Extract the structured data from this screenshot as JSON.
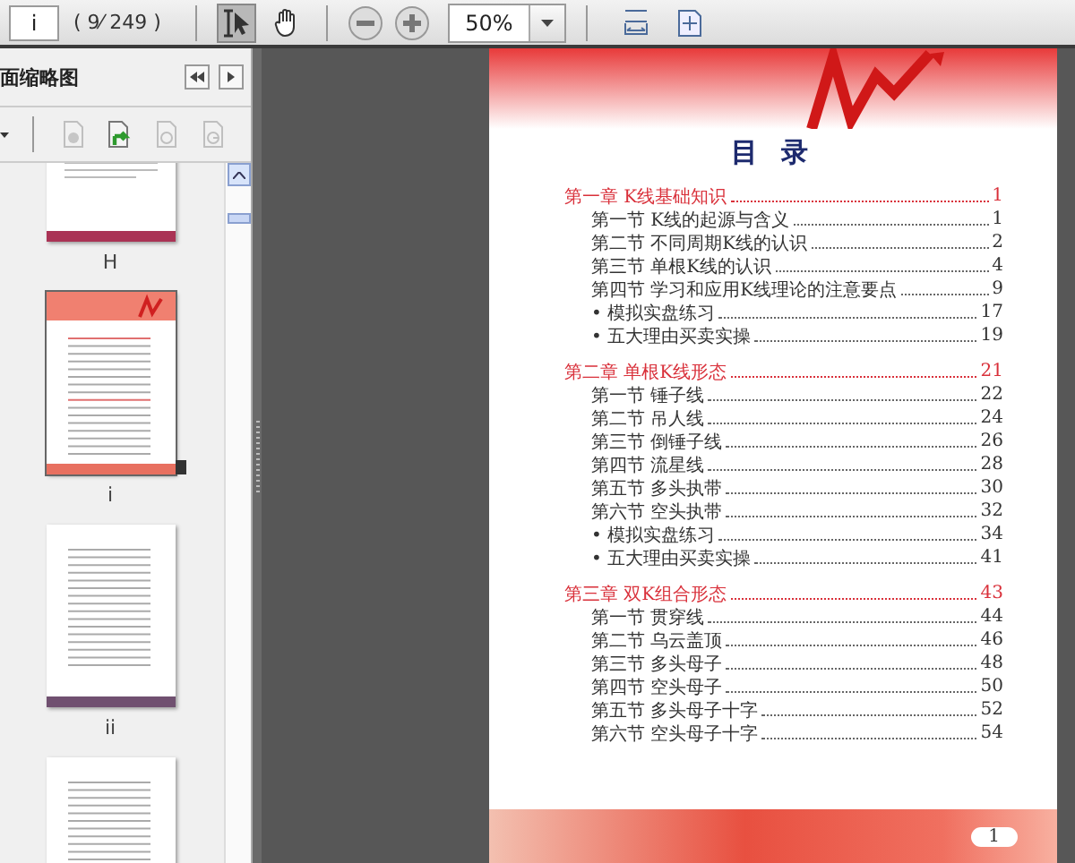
{
  "toolbar": {
    "page_field": {
      "value": "i"
    },
    "page_count": "( 9⁄ 249 )",
    "tools": [
      {
        "kind": "select",
        "selected": true
      },
      {
        "kind": "hand",
        "selected": false
      }
    ],
    "zoom_field": {
      "value": "50%"
    }
  },
  "sidebar": {
    "title": "面缩略图",
    "tools": [
      {
        "kind": "delete",
        "disabled": true
      },
      {
        "kind": "insert",
        "disabled": false
      },
      {
        "kind": "rotate",
        "disabled": true
      },
      {
        "kind": "extract",
        "disabled": true
      }
    ],
    "thumbnails": [
      {
        "kind": "text",
        "label": "H",
        "selected": false
      },
      {
        "kind": "toc",
        "label": "i",
        "selected": true
      },
      {
        "kind": "list",
        "label": "ii",
        "selected": false
      },
      {
        "kind": "list",
        "selected": false
      }
    ]
  },
  "document": {
    "title": "目 录",
    "chapters": [
      {
        "title": "第一章 K线基础知识",
        "page": "1",
        "entries": [
          {
            "title": "第一节 K线的起源与含义",
            "page": "1"
          },
          {
            "title": "第二节 不同周期K线的认识",
            "page": "2"
          },
          {
            "title": "第三节 单根K线的认识",
            "page": "4"
          },
          {
            "title": "第四节 学习和应用K线理论的注意要点",
            "page": "9"
          },
          {
            "title": "• 模拟实盘练习",
            "page": "17"
          },
          {
            "title": "• 五大理由买卖实操",
            "page": "19"
          }
        ]
      },
      {
        "title": "第二章 单根K线形态",
        "page": "21",
        "entries": [
          {
            "title": "第一节 锤子线",
            "page": "22"
          },
          {
            "title": "第二节 吊人线",
            "page": "24"
          },
          {
            "title": "第三节 倒锤子线",
            "page": "26"
          },
          {
            "title": "第四节 流星线",
            "page": "28"
          },
          {
            "title": "第五节 多头执带",
            "page": "30"
          },
          {
            "title": "第六节 空头执带",
            "page": "32"
          },
          {
            "title": "• 模拟实盘练习",
            "page": "34"
          },
          {
            "title": "• 五大理由买卖实操",
            "page": "41"
          }
        ]
      },
      {
        "title": "第三章 双K组合形态",
        "page": "43",
        "entries": [
          {
            "title": "第一节 贯穿线",
            "page": "44"
          },
          {
            "title": "第二节 乌云盖顶",
            "page": "46"
          },
          {
            "title": "第三节 多头母子",
            "page": "48"
          },
          {
            "title": "第四节 空头母子",
            "page": "50"
          },
          {
            "title": "第五节 多头母子十字",
            "page": "52"
          },
          {
            "title": "第六节 空头母子十字",
            "page": "54"
          }
        ]
      }
    ],
    "page_number": "1"
  }
}
